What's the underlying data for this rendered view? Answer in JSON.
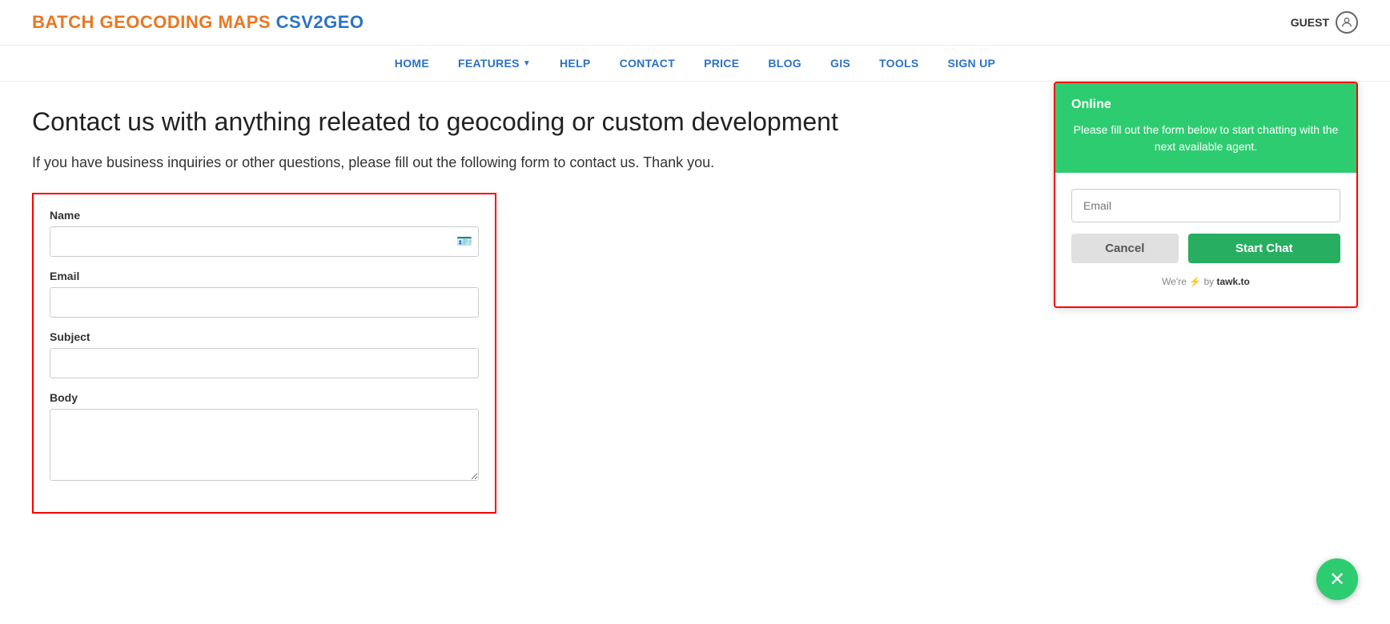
{
  "header": {
    "logo_part1": "BATCH GEOCODING MAPS",
    "logo_part2": "CSV2GEO",
    "guest_label": "GUEST"
  },
  "nav": {
    "items": [
      {
        "label": "HOME",
        "id": "home"
      },
      {
        "label": "FEATURES",
        "id": "features",
        "has_dropdown": true
      },
      {
        "label": "HELP",
        "id": "help"
      },
      {
        "label": "CONTACT",
        "id": "contact"
      },
      {
        "label": "PRICE",
        "id": "price"
      },
      {
        "label": "BLOG",
        "id": "blog"
      },
      {
        "label": "GIS",
        "id": "gis"
      },
      {
        "label": "TOOLS",
        "id": "tools"
      },
      {
        "label": "SIGN UP",
        "id": "signup"
      }
    ]
  },
  "main": {
    "title": "Contact us with anything releated to geocoding or custom development",
    "subtitle": "If you have business inquiries or other questions, please fill out the following form to contact us. Thank you."
  },
  "contact_form": {
    "name_label": "Name",
    "email_label": "Email",
    "subject_label": "Subject",
    "body_label": "Body",
    "name_placeholder": "",
    "email_placeholder": "",
    "subject_placeholder": "",
    "body_placeholder": ""
  },
  "chat_widget": {
    "status": "Online",
    "description": "Please fill out the form below to start chatting with the next available agent.",
    "email_placeholder": "Email",
    "cancel_label": "Cancel",
    "start_chat_label": "Start Chat",
    "footer_text": "We're",
    "footer_brand": "tawk.to"
  },
  "chat_close": {
    "icon": "✕"
  }
}
